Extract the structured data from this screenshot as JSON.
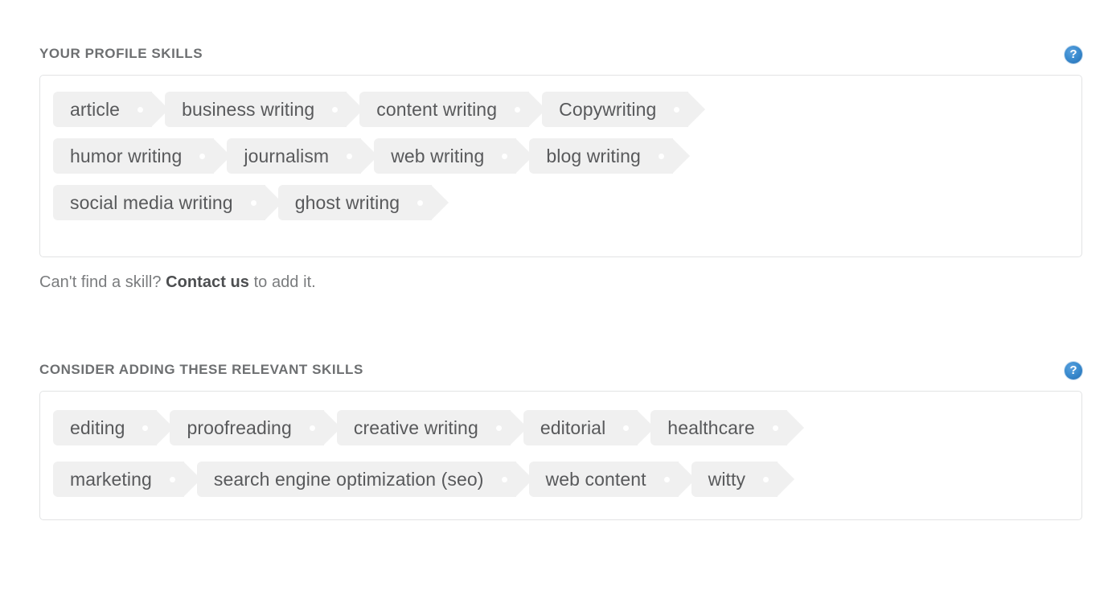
{
  "colors": {
    "tag_bg": "#f0f0f0",
    "tag_text": "#58595b",
    "section_title": "#6d6f71",
    "box_border": "#e2e3e4",
    "help_blue": "#3d8ed1",
    "helper_text": "#7a7c7e",
    "helper_link": "#4c4e50"
  },
  "sections": [
    {
      "id": "profile",
      "title": "YOUR PROFILE SKILLS",
      "help_icon": "help-circle-icon",
      "help_label": "?",
      "rows": [
        [
          "article",
          "business writing",
          "content writing",
          "Copywriting"
        ],
        [
          "humor writing",
          "journalism",
          "web writing",
          "blog writing"
        ],
        [
          "social media writing",
          "ghost writing"
        ]
      ],
      "helper": {
        "before": "Can't find a skill? ",
        "link": "Contact us",
        "after": " to add it."
      }
    },
    {
      "id": "suggested",
      "title": "CONSIDER ADDING THESE RELEVANT SKILLS",
      "help_icon": "help-circle-icon",
      "help_label": "?",
      "rows": [
        [
          "editing",
          "proofreading",
          "creative writing",
          "editorial",
          "healthcare"
        ],
        [
          "marketing",
          "search engine optimization (seo)",
          "web content",
          "witty"
        ]
      ]
    }
  ]
}
